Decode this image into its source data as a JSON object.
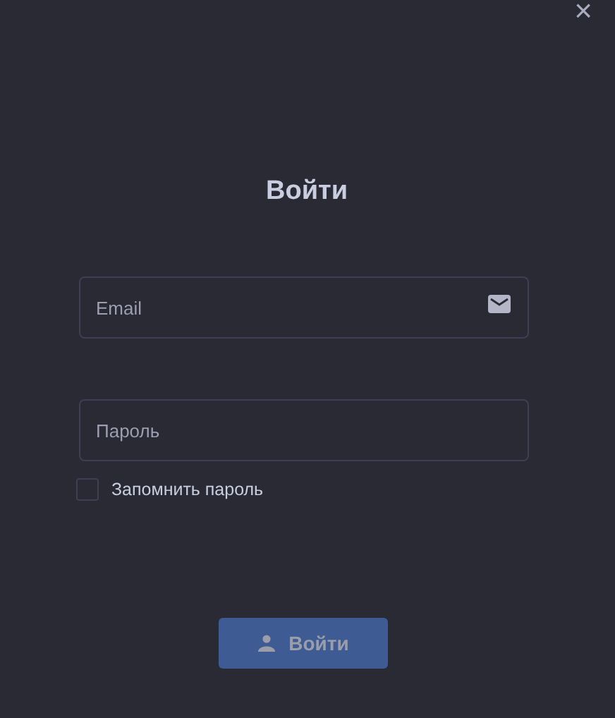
{
  "close": {
    "label": "×"
  },
  "title": "Войти",
  "fields": [
    {
      "placeholder": "Email",
      "kind": "email"
    },
    {
      "placeholder": "Пароль",
      "kind": "password"
    }
  ],
  "remember": {
    "label": "Запомнить пароль",
    "checked": false
  },
  "submit": {
    "label": "Войти",
    "disabled": true
  }
}
